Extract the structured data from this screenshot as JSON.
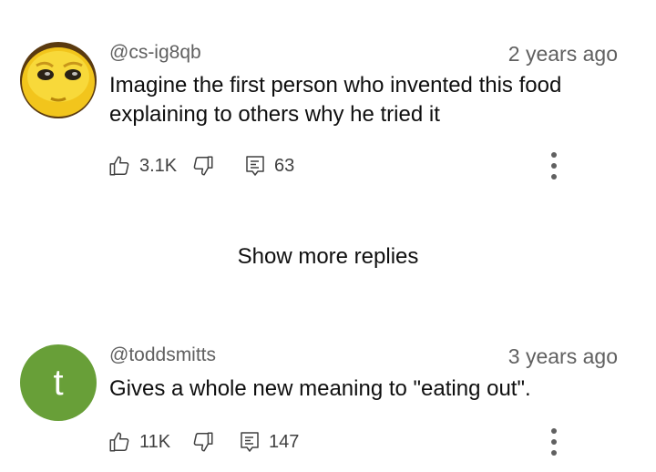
{
  "comments": [
    {
      "handle": "@cs-ig8qb",
      "time": "2 years ago",
      "text": "Imagine the first person who invented this food explaining to others why he tried it",
      "likes": "3.1K",
      "replies": "63",
      "avatar_type": "image",
      "avatar_desc": "yellow-emoji-face"
    },
    {
      "handle": "@toddsmitts",
      "time": "3 years ago",
      "text": "Gives a whole new meaning to \"eating out\".",
      "likes": "11K",
      "replies": "147",
      "avatar_type": "letter",
      "avatar_letter": "t",
      "avatar_color": "#689f38"
    }
  ],
  "show_more_label": "Show more replies",
  "icons": {
    "like": "thumbs-up-icon",
    "dislike": "thumbs-down-icon",
    "reply": "reply-comment-icon",
    "menu": "more-vertical-icon"
  }
}
